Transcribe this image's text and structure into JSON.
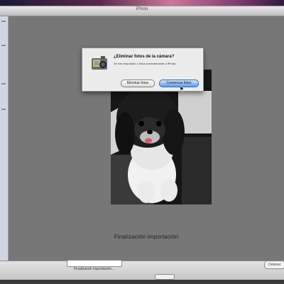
{
  "window": {
    "title": "iPhoto"
  },
  "dialog": {
    "title": "¿Eliminar fotos de la cámara?",
    "message": "Se han importado 1 fotos correctamente a iPhoto.",
    "buttons": {
      "delete": "Eliminar fotos",
      "keep": "Conservar fotos"
    },
    "icon": "iphoto-camera-icon"
  },
  "viewer": {
    "status_label": "Finalización importación"
  },
  "bottom_bar": {
    "status": "Finalizando importación...",
    "right_button": "Detener"
  },
  "colors": {
    "viewer_bg": "#777777",
    "default_button": "#5b9bea",
    "dialog_bg": "#ececec"
  }
}
